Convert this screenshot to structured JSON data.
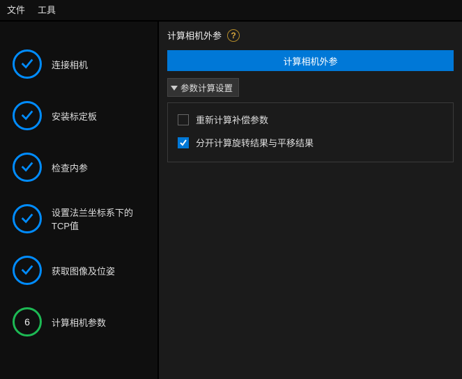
{
  "menu": {
    "file": "文件",
    "tool": "工具"
  },
  "steps": [
    {
      "label": "连接相机",
      "done": true
    },
    {
      "label": "安装标定板",
      "done": true
    },
    {
      "label": "检查内参",
      "done": true
    },
    {
      "label": "设置法兰坐标系下的TCP值",
      "done": true
    },
    {
      "label": "获取图像及位姿",
      "done": true
    },
    {
      "label": "计算相机参数",
      "done": false,
      "num": "6"
    }
  ],
  "header": {
    "title": "计算相机外参"
  },
  "button": {
    "primary": "计算相机外参"
  },
  "section": {
    "title": "参数计算设置"
  },
  "options": {
    "recalc": {
      "label": "重新计算补偿参数",
      "checked": false
    },
    "split": {
      "label": "分开计算旋转结果与平移结果",
      "checked": true
    }
  }
}
